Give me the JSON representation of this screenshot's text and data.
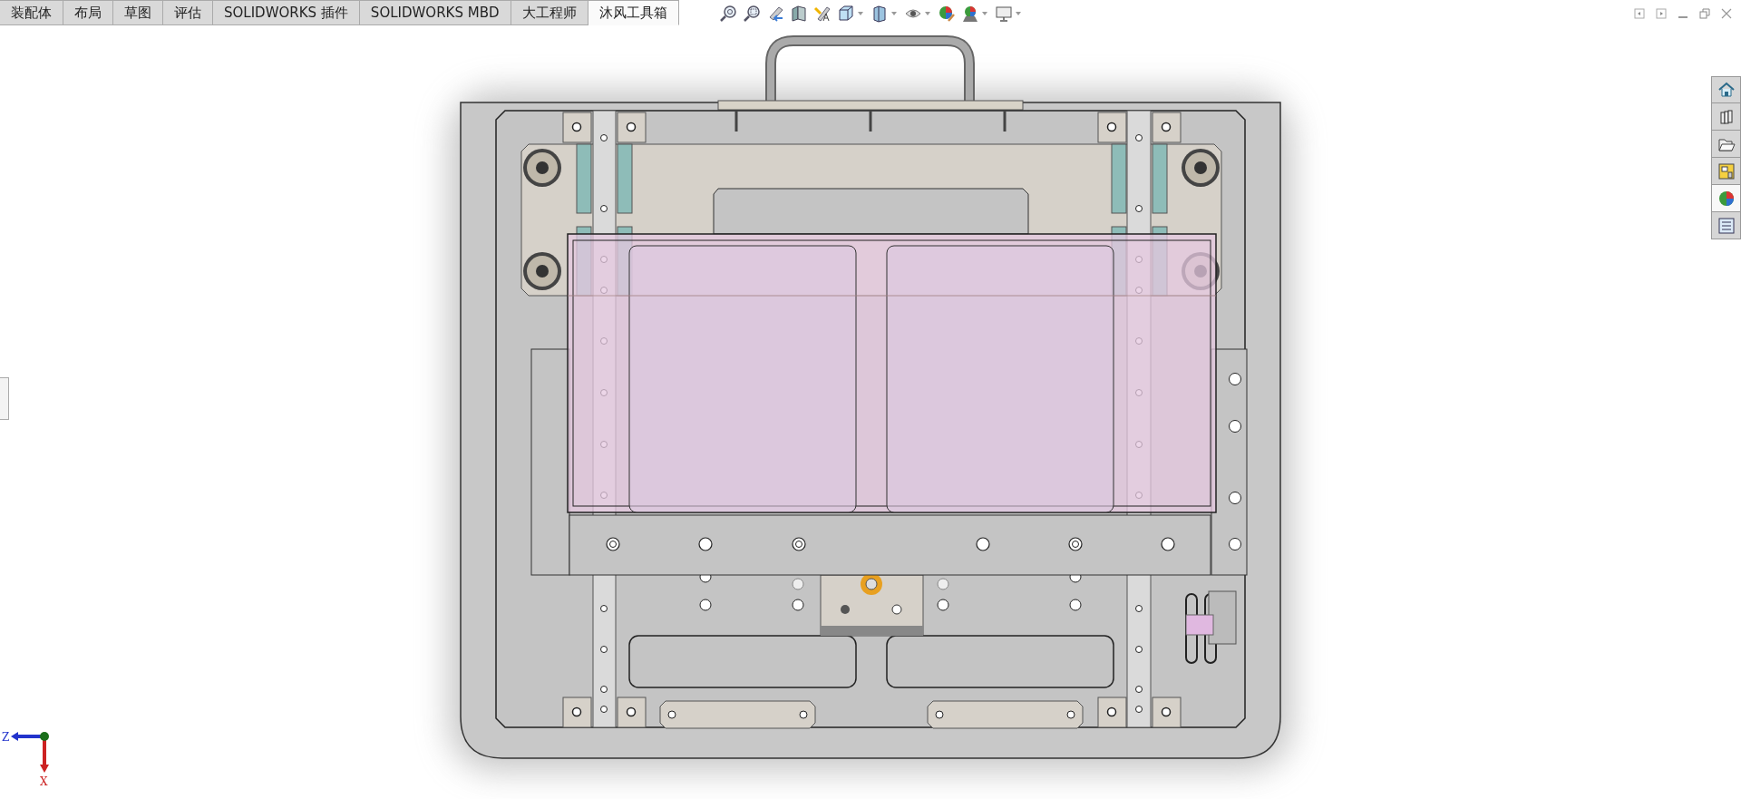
{
  "tabs": [
    {
      "label": "装配体",
      "selected": false
    },
    {
      "label": "布局",
      "selected": false
    },
    {
      "label": "草图",
      "selected": false
    },
    {
      "label": "评估",
      "selected": false
    },
    {
      "label": "SOLIDWORKS 插件",
      "selected": false
    },
    {
      "label": "SOLIDWORKS MBD",
      "selected": false
    },
    {
      "label": "大工程师",
      "selected": false
    },
    {
      "label": "沐风工具箱",
      "selected": true
    }
  ],
  "view_toolbar": [
    {
      "kind": "zoom-fit",
      "dropdown": false
    },
    {
      "kind": "zoom-area",
      "dropdown": false
    },
    {
      "kind": "previous-view",
      "dropdown": false
    },
    {
      "kind": "section",
      "dropdown": false
    },
    {
      "kind": "annotation",
      "dropdown": false
    },
    {
      "kind": "orientation",
      "dropdown": true
    },
    {
      "kind": "display-style",
      "dropdown": true
    },
    {
      "kind": "hide-show",
      "dropdown": true
    },
    {
      "kind": "appearance",
      "dropdown": false
    },
    {
      "kind": "scene",
      "dropdown": true
    },
    {
      "kind": "monitor",
      "dropdown": true
    }
  ],
  "task_pane": [
    {
      "kind": "home",
      "selected": false
    },
    {
      "kind": "parts",
      "selected": false
    },
    {
      "kind": "folder",
      "selected": false
    },
    {
      "kind": "palette",
      "selected": false
    },
    {
      "kind": "appearance",
      "selected": true
    },
    {
      "kind": "properties",
      "selected": false
    }
  ],
  "triad": {
    "horizontal_axis": "Z",
    "vertical_axis": "X"
  }
}
